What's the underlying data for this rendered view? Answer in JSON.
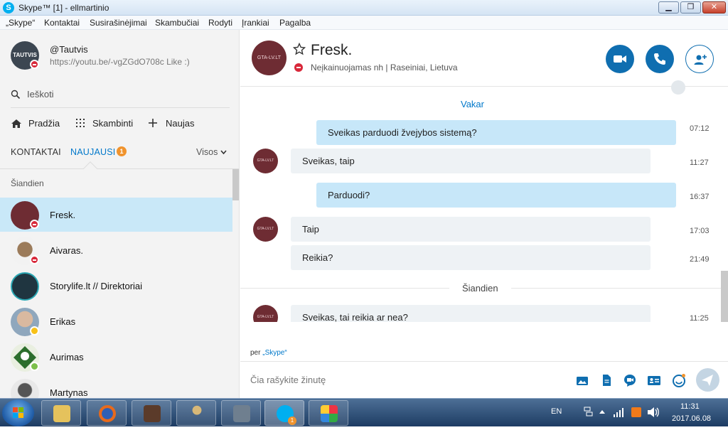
{
  "window": {
    "title": "Skype™ [1] - ellmartinio",
    "app_icon": "S",
    "min_label": "▁",
    "max_label": "❐",
    "close_label": "✕"
  },
  "menu": [
    "„Skype“",
    "Kontaktai",
    "Susirašinėjimai",
    "Skambučiai",
    "Rodyti",
    "Įrankiai",
    "Pagalba"
  ],
  "profile": {
    "avatar_text": "TAUTVIS",
    "name": "@Tautvis",
    "mood": "https://youtu.be/-vgZGdO708c Like :)"
  },
  "search": {
    "placeholder": "Ieškoti"
  },
  "nav": {
    "home": "Pradžia",
    "call": "Skambinti",
    "new": "Naujas"
  },
  "tabs": {
    "contacts": "KONTAKTAI",
    "recent": "NAUJAUSI",
    "recent_count": "1",
    "filter": "Visos"
  },
  "section_today": "Šiandien",
  "contacts": [
    {
      "name": "Fresk.",
      "status": "dnd",
      "selected": true
    },
    {
      "name": "Aivaras.",
      "status": "dnd"
    },
    {
      "name": "Storylife.lt // Direktoriai",
      "status": ""
    },
    {
      "name": "Erikas",
      "status": "away"
    },
    {
      "name": "Aurimas",
      "status": "online"
    },
    {
      "name": "Martynas",
      "status": ""
    }
  ],
  "chat": {
    "avatar_text": "GTA-LV.LT",
    "title": "Fresk.",
    "status": "Neįkainuojamas nh  |  Raseiniai, Lietuva",
    "day_yesterday": "Vakar",
    "day_today": "Šiandien",
    "messages": [
      {
        "dir": "out",
        "text": "Sveikas parduodi žvejybos sistemą?",
        "time": "07:12"
      },
      {
        "dir": "in",
        "text": "Sveikas, taip",
        "time": "11:27"
      },
      {
        "dir": "out",
        "text": "Parduodi?",
        "time": "16:37"
      },
      {
        "dir": "in",
        "text": "Taip",
        "time": "17:03"
      },
      {
        "dir": "in",
        "text": "Reikia?",
        "time": "21:49"
      },
      {
        "dir": "in",
        "text": "Sveikas, tai reikia ar nea?",
        "time": "11:25"
      }
    ],
    "via_prefix": "per",
    "via_link": "„Skype“",
    "composer_placeholder": "Čia rašykite žinutę"
  },
  "taskbar": {
    "lang": "EN",
    "time": "11:31",
    "date": "2017.06.08",
    "skype_badge": "1"
  },
  "colors": {
    "accent": "#0078ca",
    "header_button": "#0f6eb0",
    "selected_row": "#c9e8f8",
    "outgoing_bubble": "#c7e7f9",
    "incoming_bubble": "#eef2f5",
    "dnd": "#d8283a",
    "badge": "#f0932d"
  }
}
